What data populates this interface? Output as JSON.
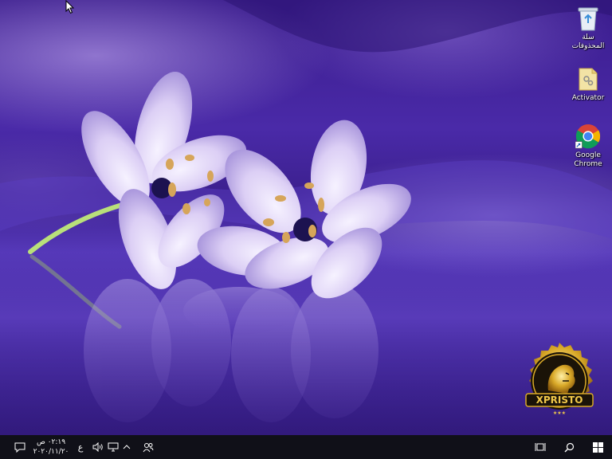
{
  "desktop": {
    "icons": [
      {
        "name": "recycle-bin",
        "label": "سلة\nالمحذوفات",
        "icon": "recycle-bin-icon"
      },
      {
        "name": "activator",
        "label": "Activator",
        "icon": "folder-icon"
      },
      {
        "name": "google-chrome",
        "label": "Google\nChrome",
        "icon": "chrome-icon"
      }
    ],
    "wallpaper": "purple-flowers",
    "logo_text": "XPRISTO"
  },
  "taskbar": {
    "clock_time": "٠٢:١٩ ص",
    "clock_date": "٢٠٢٠/١١/٢٠",
    "keyboard_lang": "ع",
    "icons": [
      "action-center-icon",
      "volume-icon",
      "network-icon",
      "chevron-up-icon",
      "people-icon",
      "task-view-icon",
      "search-icon",
      "windows-start-icon"
    ]
  },
  "colors": {
    "taskbar": "#101018",
    "wallpaper_primary": "#4a2aa8",
    "petal": "#e6ddf5"
  }
}
